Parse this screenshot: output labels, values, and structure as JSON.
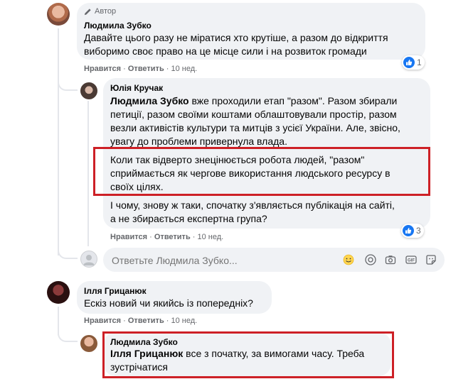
{
  "c1": {
    "author_badge": "Автор",
    "author": "Людмила Зубко",
    "text_line1": "Давайте цього разу не міратися хто крутіше, а разом до відкриття",
    "text_line2": "виборимо своє право на це місце сили і на розвиток громади",
    "reaction_count": "1",
    "like": "Нравится",
    "reply": "Ответить",
    "time": "10 нед."
  },
  "c2": {
    "author": "Юлія Кручак",
    "mention": "Людмила Зубко",
    "line1_rest": " вже проходили етап \"разом\". Разом збирали",
    "line2": "петиції, разом своїми коштами облаштовували простір, разом",
    "line3": "везли активістів культури та митців з усієї України. Але, звісно,",
    "line4": "увагу до проблеми привернула влада.",
    "hl_line1": "Коли так відверто знецінюється робота людей, \"разом\"",
    "hl_line2": "сприймається як чергове використання людського ресурсу в",
    "hl_line3": "своїх цілях.",
    "q_line1": "І чому, знову ж таки, спочатку з'являється публікація на сайті,",
    "q_line2": "а не збирається експертна група?",
    "reaction_count": "3",
    "like": "Нравится",
    "reply": "Ответить",
    "time": "10 нед."
  },
  "reply_input": {
    "placeholder": "Ответьте Людмила Зубко..."
  },
  "c3": {
    "author": "Ілля Грицанюк",
    "text": "Ескіз новий чи якийсь із попередніх?",
    "like": "Нравится",
    "reply": "Ответить",
    "time": "10 нед."
  },
  "c4": {
    "author": "Людмила Зубко",
    "mention": "Ілля Грицанюк",
    "line1_rest": " все з початку, за вимогами часу. Треба",
    "line2": "зустрічатися"
  },
  "colors": {
    "highlight": "#cd2026",
    "bubble": "#f0f2f5",
    "like_blue": "#1877f2"
  }
}
